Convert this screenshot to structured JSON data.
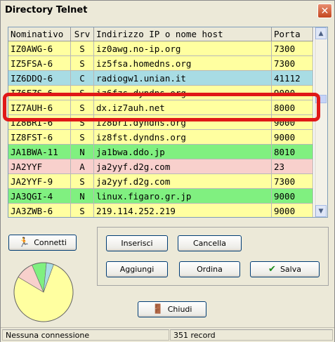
{
  "window": {
    "title": "Directory Telnet",
    "close_icon": "close-icon"
  },
  "table": {
    "columns": [
      "Nominativo",
      "Srv",
      "Indirizzo IP o nome host",
      "Porta"
    ],
    "rows": [
      {
        "call": "IZ0AWG-6",
        "srv": "S",
        "host": "iz0awg.no-ip.org",
        "port": "7300",
        "color": "#ffffa0"
      },
      {
        "call": "IZ5FSA-6",
        "srv": "S",
        "host": "iz5fsa.homedns.org",
        "port": "7300",
        "color": "#ffffa0"
      },
      {
        "call": "IZ6DDQ-6",
        "srv": "C",
        "host": "radiogw1.unian.it",
        "port": "41112",
        "color": "#a8dce4"
      },
      {
        "call": "IZ6FZS-6",
        "srv": "S",
        "host": "iz6fzs.dyndns.org",
        "port": "9000",
        "color": "#ffffa0"
      },
      {
        "call": "IZ7AUH-6",
        "srv": "S",
        "host": "dx.iz7auh.net",
        "port": "8000",
        "color": "#ffffa0"
      },
      {
        "call": "IZ8BRI-6",
        "srv": "S",
        "host": "iz8bri.dyndns.org",
        "port": "9000",
        "color": "#ffffa0"
      },
      {
        "call": "IZ8FST-6",
        "srv": "S",
        "host": "iz8fst.dyndns.org",
        "port": "9000",
        "color": "#ffffa0"
      },
      {
        "call": "JA1BWA-11",
        "srv": "N",
        "host": "ja1bwa.ddo.jp",
        "port": "8010",
        "color": "#80f080"
      },
      {
        "call": "JA2YYF",
        "srv": "A",
        "host": "ja2yyf.d2g.com",
        "port": "23",
        "color": "#f8d0cc"
      },
      {
        "call": "JA2YYF-9",
        "srv": "S",
        "host": "ja2yyf.d2g.com",
        "port": "7300",
        "color": "#ffffa0"
      },
      {
        "call": "JA3QGI-4",
        "srv": "N",
        "host": "linux.figaro.gr.jp",
        "port": "9000",
        "color": "#80f080"
      },
      {
        "call": "JA3ZWB-6",
        "srv": "S",
        "host": "219.114.252.219",
        "port": "9000",
        "color": "#ffffa0"
      }
    ]
  },
  "buttons": {
    "connetti": "Connetti",
    "inserisci": "Inserisci",
    "cancella": "Cancella",
    "aggiungi": "Aggiungi",
    "ordina": "Ordina",
    "salva": "Salva",
    "chiudi": "Chiudi"
  },
  "pie": {
    "colors": [
      "#ffffa0",
      "#f8d0cc",
      "#80f080",
      "#a8dce4"
    ],
    "fractions": [
      0.78,
      0.1,
      0.08,
      0.04
    ]
  },
  "status": {
    "connection": "Nessuna connessione",
    "records": "351 record"
  },
  "highlight_color": "#e01818"
}
